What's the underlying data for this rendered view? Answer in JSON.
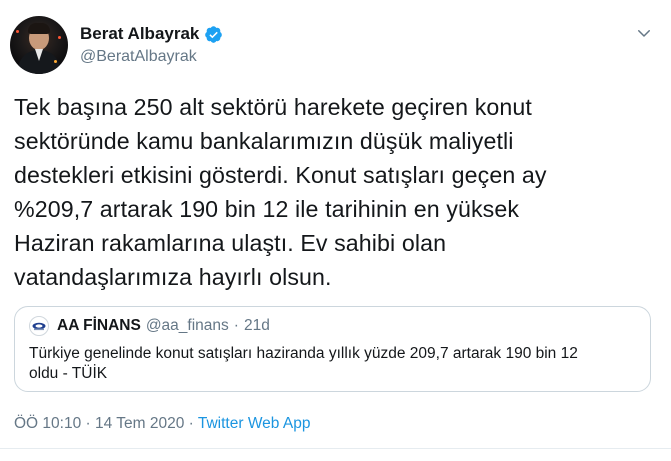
{
  "author": {
    "name": "Berat Albayrak",
    "handle": "@BeratAlbayrak",
    "verified": true,
    "avatar_icon": "profile-photo"
  },
  "tweet": {
    "text": "Tek başına 250 alt sektörü harekete geçiren konut sektöründe kamu bankalarımızın düşük maliyetli destekleri etkisini gösterdi. Konut satışları geçen ay %209,7 artarak 190 bin 12 ile tarihinin en yüksek Haziran rakamlarına ulaştı. Ev sahibi olan vatandaşlarımıza hayırlı olsun.",
    "lines": [
      "Tek başına 250 alt sektörü harekete geçiren konut",
      "sektöründe kamu bankalarımızın düşük maliyetli",
      "destekleri etkisini gösterdi. Konut satışları geçen ay",
      "%209,7 artarak 190 bin 12 ile tarihinin en yüksek",
      "Haziran rakamlarına ulaştı. Ev sahibi olan",
      "vatandaşlarımıza hayırlı olsun."
    ]
  },
  "quoted_tweet": {
    "name": "AA FİNANS",
    "handle": "@aa_finans",
    "separator": "·",
    "time": "21d",
    "lines": [
      "Türkiye genelinde konut satışları haziranda yıllık yüzde 209,7 artarak 190 bin 12",
      "oldu - TÜİK"
    ]
  },
  "meta": {
    "time": "ÖÖ 10:10",
    "separator": "·",
    "date": "14 Tem 2020",
    "source": "Twitter Web App"
  },
  "colors": {
    "text": "#14171a",
    "secondary": "#657786",
    "link": "#1b95e0",
    "verified": "#1da1f2",
    "border": "#ccd6dd"
  }
}
